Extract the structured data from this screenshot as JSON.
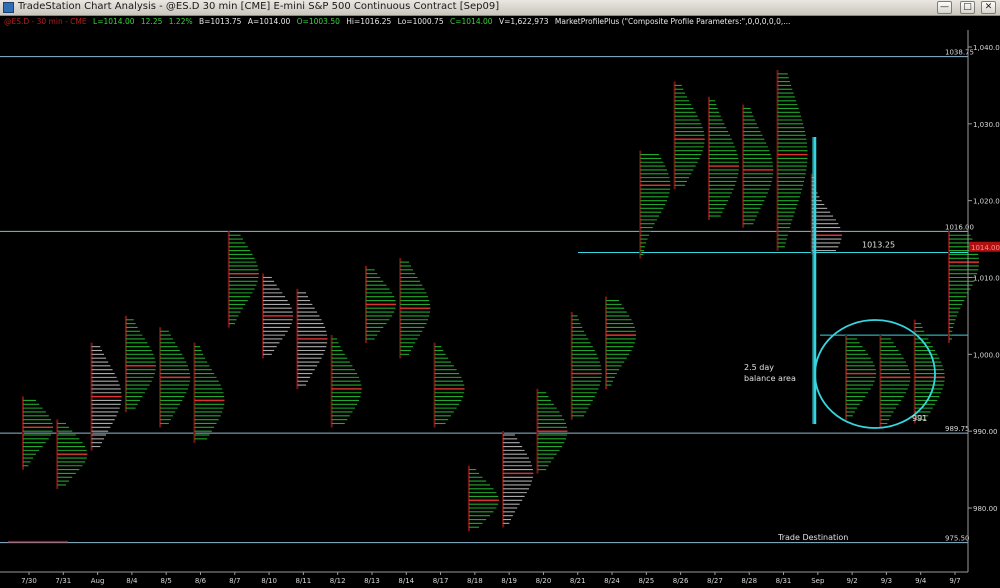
{
  "window": {
    "title": "TradeStation Chart Analysis - @ES.D 30 min [CME] E-mini S&P 500 Continuous Contract [Sep09]",
    "minimize_icon": "minimize-icon",
    "maximize_icon": "maximize-icon",
    "close_icon": "close-icon"
  },
  "status": {
    "symbol": "@ES.D - 30 min - CME",
    "last": "L=1014.00",
    "change": "12.25",
    "pct": "1.22%",
    "bid": "B=1013.75",
    "ask": "A=1014.00",
    "open": "O=1003.50",
    "high": "Hi=1016.25",
    "low": "Lo=1000.75",
    "close": "C=1014.00",
    "volume": "V=1,622,973",
    "study": "MarketProfilePlus (\"Composite Profile Parameters:\",0,0,0,0,0,..."
  },
  "colors": {
    "background": "#000000",
    "line": "#8fb8d0",
    "cyan": "#35d6e0",
    "green": "#1faa2c",
    "brown": "#7a1414",
    "gray": "#a9a9a9",
    "poc": "#e03030",
    "axis_text": "#d8d8d8",
    "last_label": "#b01010"
  },
  "chart_data": {
    "type": "market-profile",
    "y_axis": {
      "min": 975,
      "max": 1041,
      "ticks": [
        980,
        990,
        1000,
        1010,
        1020,
        1030,
        1040
      ],
      "tick_labels": [
        "980.00",
        "990.00",
        "1,000.00",
        "1,010.00",
        "1,020.00",
        "1,030.00",
        "1,040.00"
      ]
    },
    "x_axis": {
      "date_labels": [
        "7/30",
        "7/31",
        "Aug",
        "8/4",
        "8/5",
        "8/6",
        "8/7",
        "8/10",
        "8/11",
        "8/12",
        "8/13",
        "8/14",
        "8/17",
        "8/18",
        "8/19",
        "8/20",
        "8/21",
        "8/24",
        "8/25",
        "8/26",
        "8/27",
        "8/28",
        "8/31",
        "Sep",
        "9/2",
        "9/3",
        "9/4",
        "9/7"
      ]
    },
    "last_price": {
      "value": 1014.0,
      "label": "1014.00"
    },
    "levels": [
      {
        "name": "upper-reference",
        "value": 1038.75,
        "label": "1038.75"
      },
      {
        "name": "upper-balance",
        "value": 1016.0,
        "label": "1016.00"
      },
      {
        "name": "lower-reference",
        "value": 989.75,
        "label": "989.75"
      },
      {
        "name": "trade-destination",
        "value": 975.5,
        "label": "975.50"
      }
    ],
    "annotations": [
      {
        "name": "level-1013",
        "text": "1013.25",
        "value": 1013.25
      },
      {
        "name": "balance-note-line1",
        "text": "2.5 day"
      },
      {
        "name": "balance-note-line2",
        "text": "balance area"
      },
      {
        "name": "level-991",
        "text": "991"
      },
      {
        "name": "destination-note",
        "text": "Trade Destination"
      }
    ],
    "profiles": [
      {
        "date": "7/30",
        "low": 985.5,
        "high": 994.0,
        "poc": 990.5,
        "color": "green"
      },
      {
        "date": "7/31",
        "low": 983.0,
        "high": 991.0,
        "poc": 987.0,
        "color": "green"
      },
      {
        "date": "Aug",
        "low": 988.0,
        "high": 1001.0,
        "poc": 994.5,
        "color": "gray"
      },
      {
        "date": "8/4",
        "low": 993.0,
        "high": 1004.5,
        "poc": 998.5,
        "color": "green"
      },
      {
        "date": "8/5",
        "low": 991.0,
        "high": 1003.0,
        "poc": 997.0,
        "color": "green"
      },
      {
        "date": "8/6",
        "low": 989.0,
        "high": 1001.0,
        "poc": 994.0,
        "color": "green"
      },
      {
        "date": "8/7",
        "low": 1004.0,
        "high": 1015.5,
        "poc": 1010.5,
        "color": "green"
      },
      {
        "date": "8/10",
        "low": 1000.0,
        "high": 1010.0,
        "poc": 1005.0,
        "color": "gray"
      },
      {
        "date": "8/11",
        "low": 996.0,
        "high": 1008.0,
        "poc": 1002.0,
        "color": "gray"
      },
      {
        "date": "8/12",
        "low": 991.0,
        "high": 1002.0,
        "poc": 995.5,
        "color": "green"
      },
      {
        "date": "8/13",
        "low": 1002.0,
        "high": 1011.0,
        "poc": 1006.5,
        "color": "green"
      },
      {
        "date": "8/14",
        "low": 1000.0,
        "high": 1012.0,
        "poc": 1006.0,
        "color": "green"
      },
      {
        "date": "8/17",
        "low": 991.0,
        "high": 1001.0,
        "poc": 995.5,
        "color": "green"
      },
      {
        "date": "8/18",
        "low": 977.5,
        "high": 985.0,
        "poc": 981.0,
        "color": "green"
      },
      {
        "date": "8/19",
        "low": 978.0,
        "high": 989.5,
        "poc": 984.5,
        "color": "gray"
      },
      {
        "date": "8/20",
        "low": 985.0,
        "high": 995.0,
        "poc": 990.0,
        "color": "green"
      },
      {
        "date": "8/21",
        "low": 992.0,
        "high": 1005.0,
        "poc": 997.5,
        "color": "green"
      },
      {
        "date": "8/24",
        "low": 996.0,
        "high": 1007.0,
        "poc": 1002.5,
        "color": "green"
      },
      {
        "date": "8/25",
        "low": 1013.0,
        "high": 1026.0,
        "poc": 1022.0,
        "color": "green"
      },
      {
        "date": "8/26",
        "low": 1022.0,
        "high": 1035.0,
        "poc": 1028.0,
        "color": "green"
      },
      {
        "date": "8/27",
        "low": 1018.0,
        "high": 1033.0,
        "poc": 1024.5,
        "color": "green"
      },
      {
        "date": "8/28",
        "low": 1017.0,
        "high": 1032.0,
        "poc": 1024.0,
        "color": "green"
      },
      {
        "date": "8/31",
        "low": 1014.0,
        "high": 1036.5,
        "poc": 1026.0,
        "color": "green"
      },
      {
        "date": "Sep",
        "low": 1013.5,
        "high": 1023.0,
        "poc": 1015.5,
        "color": "gray"
      },
      {
        "date": "9/2",
        "low": 992.0,
        "high": 1002.0,
        "poc": 997.5,
        "color": "green"
      },
      {
        "date": "9/3",
        "low": 991.0,
        "high": 1002.0,
        "poc": 997.0,
        "color": "green"
      },
      {
        "date": "9/4",
        "low": 991.5,
        "high": 1004.0,
        "poc": 997.0,
        "color": "green"
      },
      {
        "date": "9/7",
        "low": 1002.0,
        "high": 1015.5,
        "poc": 1012.0,
        "color": "green"
      }
    ]
  }
}
